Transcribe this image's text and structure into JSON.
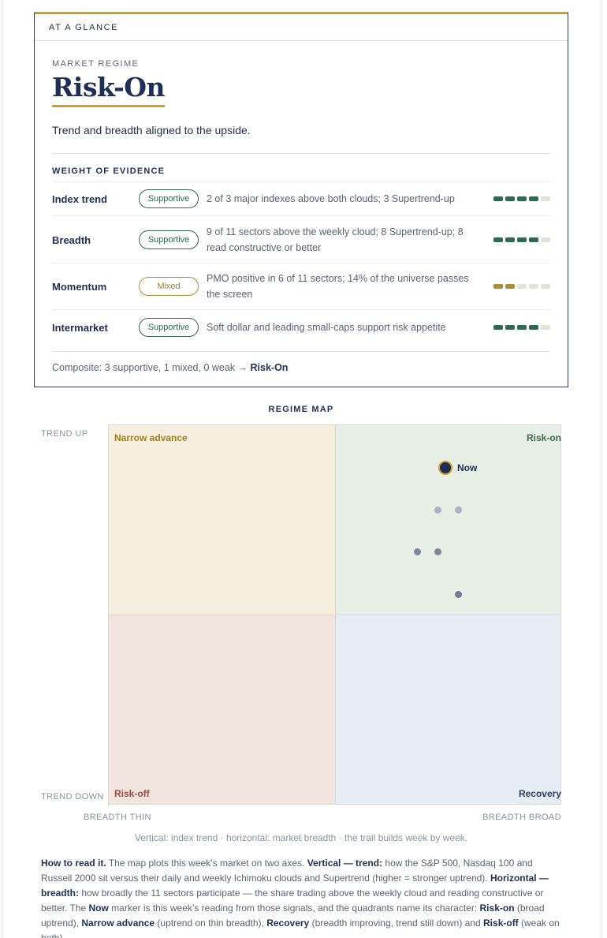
{
  "card": {
    "header": "AT A GLANCE",
    "eyebrow": "MARKET REGIME",
    "regime": "Risk-On",
    "description": "Trend and breadth aligned to the upside.",
    "evidence_title": "WEIGHT OF EVIDENCE",
    "rows": [
      {
        "name": "Index trend",
        "status": "Supportive",
        "detail": "2 of 3 major indexes above both clouds; 3 Supertrend-up",
        "score": 4,
        "max": 5
      },
      {
        "name": "Breadth",
        "status": "Supportive",
        "detail": "9 of 11 sectors above the weekly cloud; 8 Supertrend-up; 8 read constructive or better",
        "score": 4,
        "max": 5
      },
      {
        "name": "Momentum",
        "status": "Mixed",
        "detail": "PMO positive in 6 of 11 sectors; 14% of the universe passes the screen",
        "score": 2,
        "max": 5
      },
      {
        "name": "Intermarket",
        "status": "Supportive",
        "detail": "Soft dollar and leading small-caps support risk appetite",
        "score": 4,
        "max": 5
      }
    ],
    "composite_prefix": "Composite: 3 supportive, 1 mixed, 0 weak →",
    "composite_result": "Risk-On"
  },
  "map": {
    "title": "REGIME MAP",
    "y_top": "TREND UP",
    "y_bottom": "TREND DOWN",
    "x_left": "BREADTH THIN",
    "x_right": "BREADTH BROAD",
    "quadrants": {
      "narrow_advance": "Narrow advance",
      "risk_on": "Risk-on",
      "risk_off": "Risk-off",
      "recovery": "Recovery"
    },
    "now_label": "Now",
    "caption": "Vertical: index trend · horizontal: market breadth · the trail builds week by week."
  },
  "howto": {
    "lead": "How to read it.",
    "t1": " The map plots this week’s market on two axes. ",
    "b1": "Vertical — trend:",
    "t2": " how the S&P 500, Nasdaq 100 and Russell 2000 sit versus their daily and weekly Ichimoku clouds and Supertrend (higher = stronger uptrend). ",
    "b2": "Horizontal — breadth:",
    "t3": " how broadly the 11 sectors participate — the share trading above the weekly cloud and reading constructive or better. The ",
    "b3": "Now",
    "t4": " marker is this week’s reading from those signals, and the quadrants name its character: ",
    "b4": "Risk-on",
    "t5": " (broad uptrend), ",
    "b5": "Narrow advance",
    "t6": " (uptrend on thin breadth), ",
    "b6": "Recovery",
    "t7": " (breadth improving, trend still down) and ",
    "b7": "Risk-off",
    "t8": " (weak on both)."
  },
  "colors": {
    "navy": "#1d2f55",
    "gold": "#c9a227",
    "supportive": "#2e6a4e",
    "mixed": "#b08a35",
    "risk_on": "#3f6b4f",
    "narrow_advance": "#a47d22",
    "risk_off": "#a3493a",
    "recovery": "#2e3f66"
  }
}
